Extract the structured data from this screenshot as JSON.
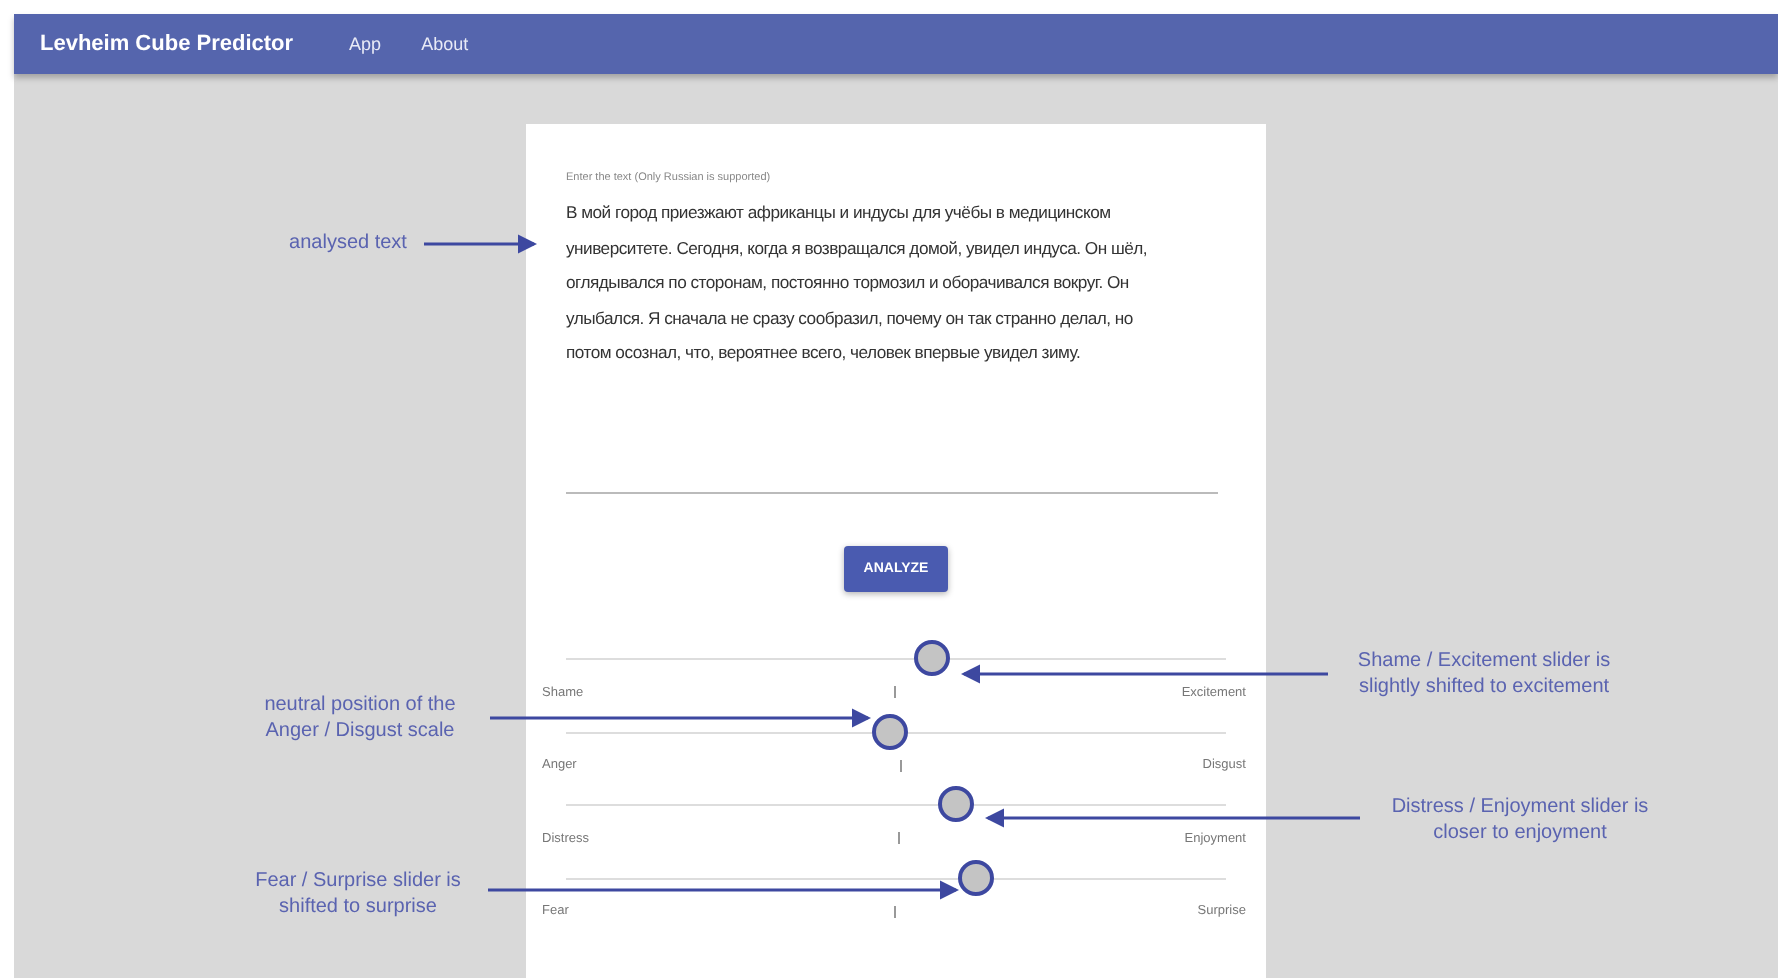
{
  "app_bar": {
    "title": "Levheim Cube Predictor",
    "nav": [
      {
        "label": "App"
      },
      {
        "label": "About"
      }
    ]
  },
  "form": {
    "label": "Enter the text (Only Russian is supported)",
    "value": "В мой город приезжают африканцы и индусы для учёбы в медицинском университете. Сегодня, когда я возвращался домой, увидел индуса. Он шёл, оглядывался по сторонам, постоянно тормозил и оборачивался вокруг. Он улыбался. Я сначала не сразу сообразил, почему он так странно делал, но потом осознал, что, вероятнее всего, человек впервые увидел зиму.",
    "button": "ANALYZE"
  },
  "sliders": [
    {
      "left": "Shame",
      "right": "Excitement",
      "level": 0.555
    },
    {
      "left": "Anger",
      "right": "Disgust",
      "level": 0.49
    },
    {
      "left": "Distress",
      "right": "Enjoyment",
      "level": 0.59
    },
    {
      "left": "Fear",
      "right": "Surprise",
      "level": 0.62
    }
  ],
  "annotations": [
    "analysed text",
    "neutral position of the Anger / Disgust scale",
    "Fear / Surprise slider is shifted to surprise",
    "Shame / Excitement slider is slightly shifted to excitement",
    "Distress / Enjoyment slider is closer to enjoyment"
  ]
}
